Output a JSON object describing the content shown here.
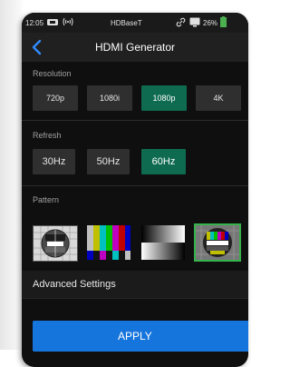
{
  "status": {
    "time": "12:05",
    "network": "HDBaseT",
    "battery": "26%"
  },
  "header": {
    "title": "HDMI Generator"
  },
  "resolution": {
    "label": "Resolution",
    "options": [
      "720p",
      "1080i",
      "1080p",
      "4K"
    ],
    "selected": "1080p"
  },
  "refresh": {
    "label": "Refresh",
    "options": [
      "30Hz",
      "50Hz",
      "60Hz"
    ],
    "selected": "60Hz"
  },
  "pattern": {
    "label": "Pattern",
    "items": [
      "circle-test-pattern",
      "color-bars-pattern",
      "gray-gradient-pattern",
      "smpte-test-card-pattern"
    ],
    "selected_index": 3
  },
  "advanced": {
    "label": "Advanced Settings"
  },
  "apply": {
    "label": "APPLY"
  },
  "colors": {
    "accent_selected": "#0e6b4f",
    "apply_blue": "#1675dc",
    "pattern_outline": "#35b24b",
    "battery_green": "#4caf50"
  }
}
